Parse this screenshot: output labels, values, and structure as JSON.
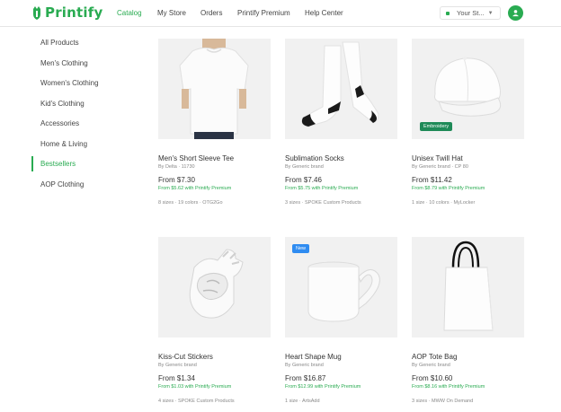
{
  "header": {
    "logo": "Printify",
    "nav": [
      "Catalog",
      "My Store",
      "Orders",
      "Printify Premium",
      "Help Center"
    ],
    "store_label": "Your St...",
    "colors": {
      "accent": "#29ab51"
    }
  },
  "sidebar": {
    "items": [
      "All Products",
      "Men's Clothing",
      "Women's Clothing",
      "Kid's Clothing",
      "Accessories",
      "Home & Living",
      "Bestsellers",
      "AOP Clothing"
    ],
    "active": "Bestsellers"
  },
  "products": [
    {
      "title": "Men's Short Sleeve Tee",
      "brand": "By Delta · 11730",
      "price": "From $7.30",
      "premium": "From $5.62 with Printify Premium",
      "meta": "8 sizes · 19 colors · OTG2Go",
      "icon": "tshirt-image"
    },
    {
      "title": "Sublimation Socks",
      "brand": "By Generic brand",
      "price": "From $7.46",
      "premium": "From $5.75 with Printify Premium",
      "meta": "3 sizes · SPOKE Custom Products",
      "icon": "socks-image"
    },
    {
      "title": "Unisex Twill Hat",
      "brand": "By Generic brand · CP 80",
      "price": "From $11.42",
      "premium": "From $8.79 with Printify Premium",
      "meta": "1 size · 10 colors · MyLocker",
      "badge": "Embroidery",
      "icon": "hat-image"
    },
    {
      "title": "Kiss-Cut Stickers",
      "brand": "By Generic brand",
      "price": "From $1.34",
      "premium": "From $1.03 with Printify Premium",
      "meta": "4 sizes · SPOKE Custom Products",
      "icon": "sticker-image"
    },
    {
      "title": "Heart Shape Mug",
      "brand": "By Generic brand",
      "price": "From $16.87",
      "premium": "From $12.99 with Printify Premium",
      "meta": "1 size · ArtsAdd",
      "badge": "New",
      "icon": "mug-image"
    },
    {
      "title": "AOP Tote Bag",
      "brand": "By Generic brand",
      "price": "From $10.60",
      "premium": "From $8.16 with Printify Premium",
      "meta": "3 sizes · MWW On Demand",
      "icon": "tote-bag-image"
    }
  ]
}
